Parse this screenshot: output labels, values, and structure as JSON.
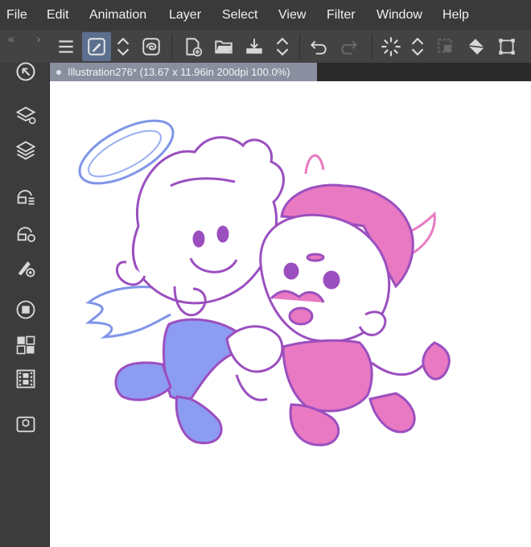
{
  "menu": [
    {
      "id": "file",
      "label": "File"
    },
    {
      "id": "edit",
      "label": "Edit"
    },
    {
      "id": "animation",
      "label": "Animation"
    },
    {
      "id": "layer",
      "label": "Layer"
    },
    {
      "id": "select",
      "label": "Select"
    },
    {
      "id": "view",
      "label": "View"
    },
    {
      "id": "filter",
      "label": "Filter"
    },
    {
      "id": "window",
      "label": "Window"
    },
    {
      "id": "help",
      "label": "Help"
    }
  ],
  "toolbar": {
    "nav_back": "«",
    "nav_forward": "›",
    "buttons": [
      {
        "id": "menu",
        "icon": "hamburger-icon"
      },
      {
        "id": "brush-settings",
        "icon": "brush-square-icon",
        "active": true
      },
      {
        "id": "up-down-1",
        "icon": "chevron-updown-icon"
      },
      {
        "id": "lasso",
        "icon": "lasso-icon"
      },
      {
        "id": "new",
        "icon": "new-document-icon"
      },
      {
        "id": "open",
        "icon": "open-folder-icon"
      },
      {
        "id": "save",
        "icon": "save-tray-icon"
      },
      {
        "id": "up-down-2",
        "icon": "chevron-updown-icon"
      },
      {
        "id": "undo",
        "icon": "undo-icon"
      },
      {
        "id": "redo",
        "icon": "redo-icon"
      },
      {
        "id": "loading",
        "icon": "spinner-icon"
      },
      {
        "id": "up-down-3",
        "icon": "chevron-updown-icon"
      },
      {
        "id": "selection",
        "icon": "selection-marquee-icon"
      },
      {
        "id": "fill",
        "icon": "fill-bucket-icon"
      },
      {
        "id": "transform",
        "icon": "transform-icon"
      }
    ]
  },
  "palette": [
    {
      "id": "navigator",
      "icon": "navigator-icon"
    },
    {
      "id": "layer-property",
      "icon": "layer-property-icon"
    },
    {
      "id": "layers",
      "icon": "layers-icon"
    },
    {
      "id": "sub-tool",
      "icon": "sub-tool-icon"
    },
    {
      "id": "tool-property",
      "icon": "tool-property-icon"
    },
    {
      "id": "brush-size",
      "icon": "brush-size-icon"
    },
    {
      "id": "color-wheel",
      "icon": "color-wheel-icon"
    },
    {
      "id": "color-set",
      "icon": "color-set-icon"
    },
    {
      "id": "timeline",
      "icon": "timeline-film-icon"
    },
    {
      "id": "material",
      "icon": "material-box-icon"
    }
  ],
  "document": {
    "tab_title": "Illustration276* (13.67 x 11.96in 200dpi 100.0%)"
  },
  "colors": {
    "menubar_bg": "#3a3a3a",
    "toolbar_bg": "#434343",
    "accent_active": "#5c6f8f",
    "tab_bg": "#8a8fa0",
    "stroke_purple": "#9b4fbf",
    "angel_blue": "#8c9cf2",
    "devil_pink": "#e879c2",
    "halo_blue": "#7f95e8"
  }
}
